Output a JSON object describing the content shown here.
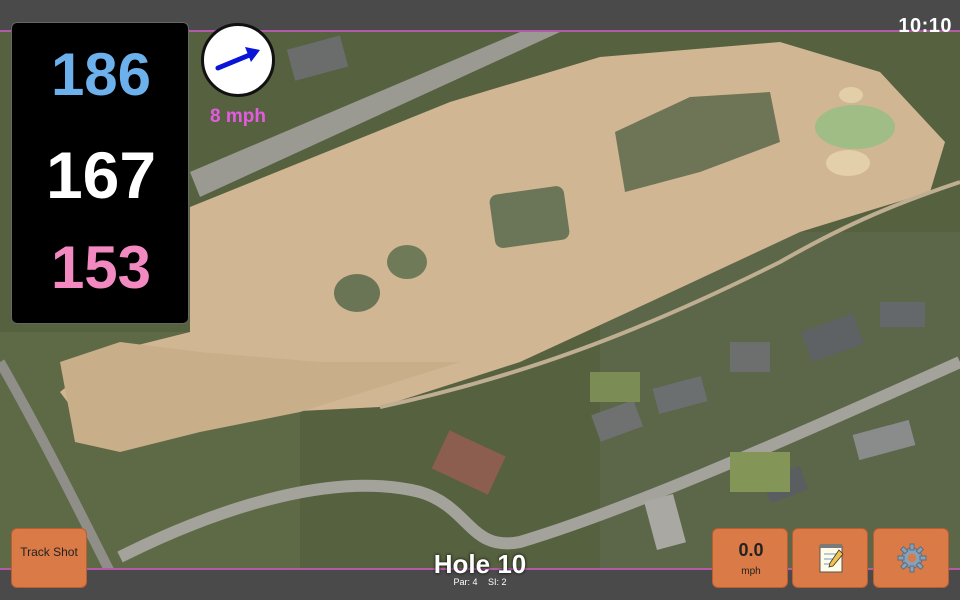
{
  "status": {
    "time": "10:10"
  },
  "distances": {
    "back": "186",
    "middle": "167",
    "front": "153"
  },
  "wind": {
    "speed": "8 mph",
    "icon": "wind-arrow-icon"
  },
  "hole": {
    "title": "Hole 10",
    "par": "Par: 4",
    "stroke_index": "SI: 2"
  },
  "buttons": {
    "track_shot": "Track Shot",
    "speed_value": "0.0",
    "speed_unit": "mph",
    "notes_icon": "notepad-icon",
    "settings_icon": "gear-icon"
  },
  "colors": {
    "back": "#6db1ec",
    "middle": "#ffffff",
    "front": "#f28ac1",
    "wind_text": "#e35be0",
    "button": "#d97a47",
    "map_border": "#b55aa8"
  }
}
